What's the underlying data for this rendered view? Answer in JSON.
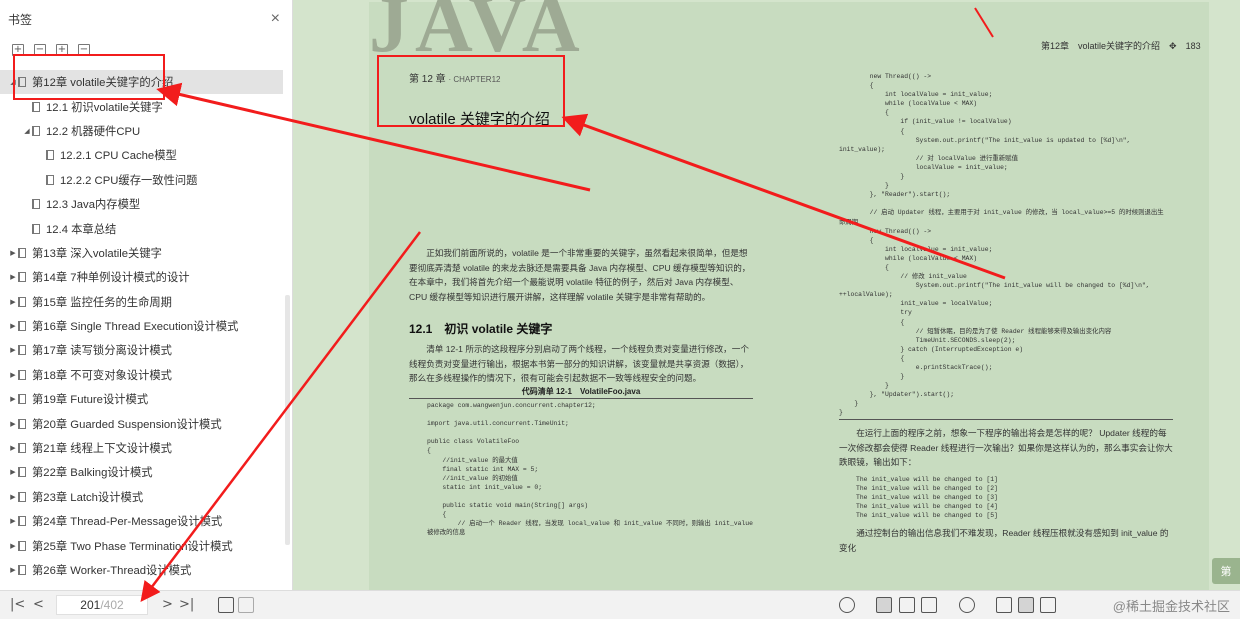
{
  "sidebar": {
    "title": "书签",
    "close_glyph": "×",
    "tools": [
      "expand-all-icon",
      "collapse-all-icon",
      "add-bookmark-icon",
      "remove-bookmark-icon"
    ],
    "items": [
      {
        "label": "第12章 volatile关键字的介绍",
        "level": 0,
        "expanded": true,
        "active": true
      },
      {
        "label": "12.1 初识volatile关键字",
        "level": 1,
        "expanded": null,
        "active": false
      },
      {
        "label": "12.2 机器硬件CPU",
        "level": 1,
        "expanded": true,
        "active": false
      },
      {
        "label": "12.2.1 CPU Cache模型",
        "level": 2,
        "expanded": null,
        "active": false
      },
      {
        "label": "12.2.2 CPU缓存一致性问题",
        "level": 2,
        "expanded": null,
        "active": false
      },
      {
        "label": "12.3 Java内存模型",
        "level": 1,
        "expanded": null,
        "active": false
      },
      {
        "label": "12.4 本章总结",
        "level": 1,
        "expanded": null,
        "active": false
      },
      {
        "label": "第13章 深入volatile关键字",
        "level": 0,
        "expanded": false,
        "active": false
      },
      {
        "label": "第14章 7种单例设计模式的设计",
        "level": 0,
        "expanded": false,
        "active": false
      },
      {
        "label": "第15章 监控任务的生命周期",
        "level": 0,
        "expanded": false,
        "active": false
      },
      {
        "label": "第16章 Single Thread Execution设计模式",
        "level": 0,
        "expanded": false,
        "active": false
      },
      {
        "label": "第17章 读写锁分离设计模式",
        "level": 0,
        "expanded": false,
        "active": false
      },
      {
        "label": "第18章 不可变对象设计模式",
        "level": 0,
        "expanded": false,
        "active": false
      },
      {
        "label": "第19章 Future设计模式",
        "level": 0,
        "expanded": false,
        "active": false
      },
      {
        "label": "第20章 Guarded Suspension设计模式",
        "level": 0,
        "expanded": false,
        "active": false
      },
      {
        "label": "第21章 线程上下文设计模式",
        "level": 0,
        "expanded": false,
        "active": false
      },
      {
        "label": "第22章 Balking设计模式",
        "level": 0,
        "expanded": false,
        "active": false
      },
      {
        "label": "第23章 Latch设计模式",
        "level": 0,
        "expanded": false,
        "active": false
      },
      {
        "label": "第24章 Thread-Per-Message设计模式",
        "level": 0,
        "expanded": false,
        "active": false
      },
      {
        "label": "第25章 Two Phase Termination设计模式",
        "level": 0,
        "expanded": false,
        "active": false
      },
      {
        "label": "第26章 Worker-Thread设计模式",
        "level": 0,
        "expanded": false,
        "active": false
      }
    ]
  },
  "bottombar": {
    "nav_first": "|<",
    "nav_prev": "<",
    "page_current": "201",
    "page_total": "/402",
    "nav_next": ">",
    "nav_last": ">|",
    "watermark": "@稀土掘金技术社区"
  },
  "document": {
    "background_word": "JAVA",
    "running_head": "第12章　volatile关键字的介绍　✥　183",
    "chapter_label": "第 12 章",
    "chapter_label_en": "· CHAPTER12",
    "chapter_title": "volatile 关键字的介绍",
    "intro_paragraph": "正如我们前面所说的，volatile 是一个非常重要的关键字，虽然看起来很简单，但是想要彻底弄清楚 volatile 的来龙去脉还是需要具备 Java 内存模型、CPU 缓存模型等知识的，在本章中，我们将首先介绍一个最能说明 volatile 特征的例子，然后对 Java 内存模型、CPU 缓存模型等知识进行展开讲解，这样理解 volatile 关键字是非常有帮助的。",
    "section_title": "12.1　初识 volatile 关键字",
    "section_paragraph": "清单 12-1 所示的这段程序分别启动了两个线程，一个线程负责对变量进行修改，一个线程负责对变量进行输出，根据本书第一部分的知识讲解，该变量就是共享资源（数据），那么在多线程操作的情况下，很有可能会引起数据不一致等线程安全的问题。",
    "listing_caption": "代码清单 12-1　VolatileFoo.java",
    "listing_code": "package com.wangwenjun.concurrent.chapter12;\n\nimport java.util.concurrent.TimeUnit;\n\npublic class VolatileFoo\n{\n    //init_value 的最大值\n    final static int MAX = 5;\n    //init_value 的初始值\n    static int init_value = 0;\n\n    public static void main(String[] args)\n    {\n        // 启动一个 Reader 线程，当发现 local_value 和 init_value 不同时，则输出 init_value\n被修改的信息",
    "right_code": "        new Thread(() ->\n        {\n            int localValue = init_value;\n            while (localValue < MAX)\n            {\n                if (init_value != localValue)\n                {\n                    System.out.printf(\"The init_value is updated to [%d]\\n\",\ninit_value);\n                    // 对 localValue 进行重新赋值\n                    localValue = init_value;\n                }\n            }\n        }, \"Reader\").start();\n\n        // 启动 Updater 线程，主要用于对 init_value 的修改，当 local_value>=5 的时候则退出生\n命周期\n        new Thread(() ->\n        {\n            int localValue = init_value;\n            while (localValue < MAX)\n            {\n                // 修改 init_value\n                    System.out.printf(\"The init_value will be changed to [%d]\\n\",\n++localValue);\n                init_value = localValue;\n                try\n                {\n                    // 短暂休眠，目的是为了使 Reader 线程能够来得及输出变化内容\n                    TimeUnit.SECONDS.sleep(2);\n                } catch (InterruptedException e)\n                {\n                    e.printStackTrace();\n                }\n            }\n        }, \"Updater\").start();\n    }\n}",
    "right_paragraph": "在运行上面的程序之前，想象一下程序的输出将会是怎样的呢？ Updater 线程的每一次修改都会使得 Reader 线程进行一次输出？如果你是这样认为的，那么事实会让你大跌眼镜，输出如下：",
    "output_code": "The init_value will be changed to [1]\nThe init_value will be changed to [2]\nThe init_value will be changed to [3]\nThe init_value will be changed to [4]\nThe init_value will be changed to [5]",
    "right_paragraph_2": "通过控制台的输出信息我们不难发现，Reader 线程压根就没有感知到 init_value 的变化",
    "next_button": "第"
  },
  "colors": {
    "annotation": "#f21c1c",
    "reader_background": "#d4e4cc",
    "active_toc": "#e3e3e3"
  }
}
